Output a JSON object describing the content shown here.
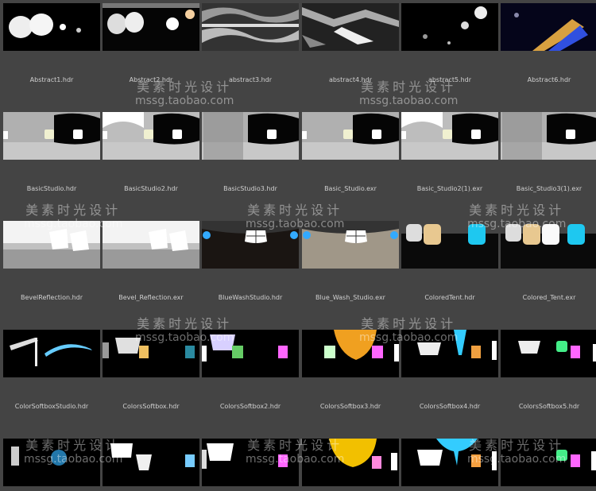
{
  "rows": [
    {
      "labels": [
        "Abstract1.hdr",
        "Abstract2.hdr",
        "abstract3.hdr",
        "abstract4.hdr",
        "abstract5.hdr",
        "Abstract6.hdr"
      ],
      "thumb_style": "abstract"
    },
    {
      "labels": [
        "BasicStudio.hdr",
        "BasicStudio2.hdr",
        "BasicStudio3.hdr",
        "Basic_Studio.exr",
        "Basic_Studio2(1).exr",
        "Basic_Studio3(1).exr"
      ],
      "thumb_style": "studio"
    },
    {
      "labels": [
        "BevelReflection.hdr",
        "Bevel_Reflection.exr",
        "BlueWashStudio.hdr",
        "Blue_Wash_Studio.exr",
        "ColoredTent.hdr",
        "Colored_Tent.exr"
      ],
      "thumb_style": "mixed"
    },
    {
      "labels": [
        "ColorSoftboxStudio.hdr",
        "ColorsSoftbox.hdr",
        "ColorsSoftbox2.hdr",
        "ColorsSoftbox3.hdr",
        "ColorsSoftbox4.hdr",
        "ColorsSoftbox5.hdr"
      ],
      "thumb_style": "softbox"
    }
  ],
  "watermark": {
    "cn": "美素时光设计",
    "en": "mssg.taobao.com"
  },
  "colors": {
    "background": "#444444",
    "label": "#d0d0d0"
  }
}
